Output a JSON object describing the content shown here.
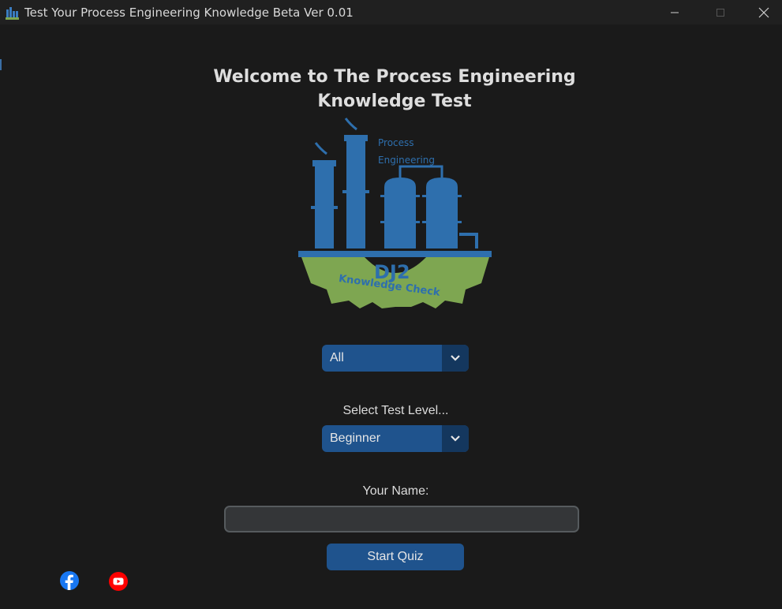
{
  "window": {
    "title": "Test Your Process Engineering Knowledge Beta Ver 0.01",
    "minimize_glyph": "—",
    "maximize_glyph": "☐",
    "close_glyph": "✕"
  },
  "heading": {
    "line1": "Welcome to The Process Engineering",
    "line2": "Knowledge Test"
  },
  "logo": {
    "top_text_line1": "Process",
    "top_text_line2": "Engineering",
    "badge": "DJ2",
    "gear_text": "Knowledge Check"
  },
  "category_select": {
    "selected": "All",
    "arrow_icon": "chevron-down-icon"
  },
  "level_section": {
    "label": "Select Test Level...",
    "selected": "Beginner",
    "arrow_icon": "chevron-down-icon"
  },
  "name_section": {
    "label": "Your Name:",
    "value": "",
    "placeholder": ""
  },
  "start_button": {
    "label": "Start Quiz"
  },
  "social": {
    "facebook_icon": "facebook-icon",
    "youtube_icon": "youtube-icon"
  },
  "colors": {
    "background": "#1a1a1a",
    "accent": "#1f538d",
    "accent_dark": "#14375e",
    "input_bg": "#343638",
    "logo_blue": "#2e6fad",
    "logo_green": "#7ea651"
  }
}
